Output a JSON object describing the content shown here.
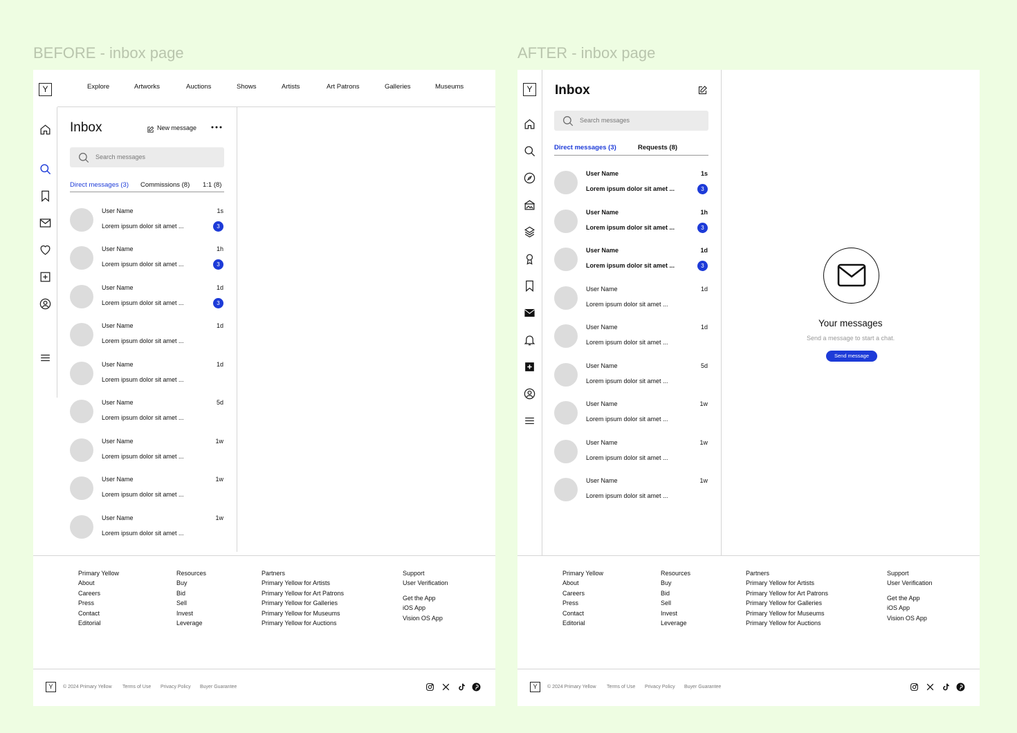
{
  "frames": {
    "before_title": "BEFORE - inbox page",
    "after_title": "AFTER - inbox page"
  },
  "logo_letter": "Y",
  "nav": [
    "Explore",
    "Artworks",
    "Auctions",
    "Shows",
    "Artists",
    "Art Patrons",
    "Galleries",
    "Museums"
  ],
  "before": {
    "inbox_title": "Inbox",
    "new_message_label": "New message",
    "more_icon": "more-horizontal-icon",
    "search_placeholder": "Search messages",
    "tabs": [
      "Direct messages (3)",
      "Commissions (8)",
      "1:1 (8)"
    ],
    "rail_icons": [
      "home-icon",
      "search-icon",
      "bookmark-icon",
      "mail-icon",
      "heart-icon",
      "plus-square-icon",
      "user-circle-icon",
      "menu-icon"
    ],
    "messages": [
      {
        "name": "User Name",
        "preview": "Lorem ipsum dolor sit amet ...",
        "time": "1s",
        "badge": "3"
      },
      {
        "name": "User Name",
        "preview": "Lorem ipsum dolor sit amet ...",
        "time": "1h",
        "badge": "3"
      },
      {
        "name": "User Name",
        "preview": "Lorem ipsum dolor sit amet ...",
        "time": "1d",
        "badge": "3"
      },
      {
        "name": "User Name",
        "preview": "Lorem ipsum dolor sit amet ...",
        "time": "1d",
        "badge": ""
      },
      {
        "name": "User Name",
        "preview": "Lorem ipsum dolor sit amet ...",
        "time": "1d",
        "badge": ""
      },
      {
        "name": "User Name",
        "preview": "Lorem ipsum dolor sit amet ...",
        "time": "5d",
        "badge": ""
      },
      {
        "name": "User Name",
        "preview": "Lorem ipsum dolor sit amet ...",
        "time": "1w",
        "badge": ""
      },
      {
        "name": "User Name",
        "preview": "Lorem ipsum dolor sit amet ...",
        "time": "1w",
        "badge": ""
      },
      {
        "name": "User Name",
        "preview": "Lorem ipsum dolor sit amet ...",
        "time": "1w",
        "badge": ""
      }
    ]
  },
  "after": {
    "inbox_title": "Inbox",
    "compose_icon": "compose-icon",
    "search_placeholder": "Search messages",
    "tabs": [
      "Direct messages (3)",
      "Requests (8)"
    ],
    "rail_icons": [
      "home-icon",
      "search-icon",
      "compass-icon",
      "gallery-icon",
      "museum-icon",
      "patron-icon",
      "bookmark-icon",
      "mail-filled-icon",
      "bell-icon",
      "plus-square-filled-icon",
      "user-circle-icon",
      "menu-icon"
    ],
    "messages": [
      {
        "name": "User Name",
        "preview": "Lorem ipsum dolor sit amet ...",
        "time": "1s",
        "badge": "3",
        "unread": true
      },
      {
        "name": "User Name",
        "preview": "Lorem ipsum dolor sit amet ...",
        "time": "1h",
        "badge": "3",
        "unread": true
      },
      {
        "name": "User Name",
        "preview": "Lorem ipsum dolor sit amet ...",
        "time": "1d",
        "badge": "3",
        "unread": true
      },
      {
        "name": "User Name",
        "preview": "Lorem ipsum dolor sit amet ...",
        "time": "1d",
        "badge": "",
        "unread": false
      },
      {
        "name": "User Name",
        "preview": "Lorem ipsum dolor sit amet ...",
        "time": "1d",
        "badge": "",
        "unread": false
      },
      {
        "name": "User Name",
        "preview": "Lorem ipsum dolor sit amet ...",
        "time": "5d",
        "badge": "",
        "unread": false
      },
      {
        "name": "User Name",
        "preview": "Lorem ipsum dolor sit amet ...",
        "time": "1w",
        "badge": "",
        "unread": false
      },
      {
        "name": "User Name",
        "preview": "Lorem ipsum dolor sit amet ...",
        "time": "1w",
        "badge": "",
        "unread": false
      },
      {
        "name": "User Name",
        "preview": "Lorem ipsum dolor sit amet ...",
        "time": "1w",
        "badge": "",
        "unread": false
      }
    ],
    "empty_state": {
      "icon": "mail-icon",
      "title": "Your messages",
      "subtitle": "Send a message to start a chat.",
      "button": "Send message"
    }
  },
  "footer": {
    "columns": [
      [
        "Primary Yellow",
        "About",
        "Careers",
        "Press",
        "Contact",
        "Editorial"
      ],
      [
        "Resources",
        "Buy",
        "Bid",
        "Sell",
        "Invest",
        "Leverage"
      ],
      [
        "Partners",
        "Primary Yellow for Artists",
        "Primary Yellow for Art Patrons",
        "Primary Yellow for Galleries",
        "Primary Yellow for Museums",
        "Primary Yellow for Auctions"
      ],
      [
        "Support",
        "User Verification"
      ]
    ],
    "apps": [
      "Get the App",
      "iOS App",
      "Vision OS App"
    ],
    "legal": [
      "© 2024 Primary Yellow",
      "Terms of Use",
      "Privacy Policy",
      "Buyer Guarantee"
    ],
    "social_icons": [
      "instagram-icon",
      "x-icon",
      "tiktok-icon",
      "pinterest-icon"
    ]
  },
  "colors": {
    "background": "#eefde2",
    "frame_title": "#b9c5ad",
    "accent": "#1d3bd8",
    "avatar": "#dcdcdc",
    "search_bg": "#ebebeb"
  }
}
